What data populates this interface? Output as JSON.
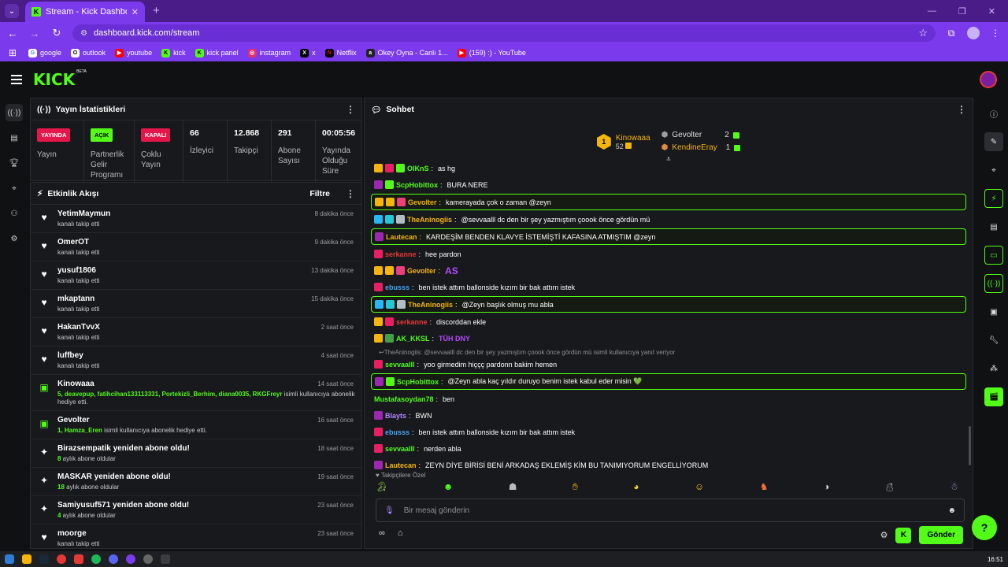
{
  "browser": {
    "tab_title": "Stream - Kick Dashboard",
    "url": "dashboard.kick.com/stream",
    "bookmarks": [
      "google",
      "outlook",
      "youtube",
      "kick",
      "kick panel",
      "instagram",
      "x",
      "Netflix",
      "Okey Oyna - Canlı 1...",
      "(159) :) - YouTube"
    ]
  },
  "brand": {
    "logo": "KICK",
    "beta": "BETA",
    "accent": "#53fc18"
  },
  "stats_panel": {
    "title": "Yayın İstatistikleri",
    "items": [
      {
        "badge": "YAYINDA",
        "label": "Yayın"
      },
      {
        "badge": "AÇIK",
        "label": "Partnerlik Gelir Programı"
      },
      {
        "badge": "KAPALI",
        "label": "Çoklu Yayın"
      },
      {
        "value": "66",
        "label": "İzleyici"
      },
      {
        "value": "12.868",
        "label": "Takipçi"
      },
      {
        "value": "291",
        "label": "Abone Sayısı"
      },
      {
        "value": "00:05:56",
        "label": "Yayında Olduğu Süre"
      }
    ]
  },
  "activity": {
    "title": "Etkinlik Akışı",
    "filter": "Filtre",
    "items": [
      {
        "icon": "heart-icon",
        "name": "YetimMaymun",
        "sub": "kanalı takip etti",
        "time": "8 dakika önce"
      },
      {
        "icon": "heart-icon",
        "name": "OmerOT",
        "sub": "kanalı takip etti",
        "time": "9 dakika önce"
      },
      {
        "icon": "heart-icon",
        "name": "yusuf1806",
        "sub": "kanalı takip etti",
        "time": "13 dakika önce"
      },
      {
        "icon": "heart-icon",
        "name": "mkaptann",
        "sub": "kanalı takip etti",
        "time": "15 dakika önce"
      },
      {
        "icon": "heart-icon",
        "name": "HakanTvvX",
        "sub": "kanalı takip etti",
        "time": "2 saat önce"
      },
      {
        "icon": "heart-icon",
        "name": "luffbey",
        "sub": "kanalı takip etti",
        "time": "4 saat önce"
      },
      {
        "icon": "gift-icon",
        "name": "Kinowaaa",
        "sub_green": "5, deavepup, fatihcihan133113331, Portekizli_Berhim, diana0035, RKGFreyr",
        "sub": " isimli kullanıcıya abonelik hediye etti.",
        "time": "14 saat önce"
      },
      {
        "icon": "gift-icon",
        "name": "Gevolter",
        "sub_green": "1, Hamza_Eren",
        "sub": " isimli kullanıcıya abonelik hediye etti.",
        "time": "16 saat önce"
      },
      {
        "icon": "sparkle-icon",
        "name": "Birazsempatik yeniden abone oldu!",
        "sub_green": "8",
        "sub": " aylık abone oldular",
        "time": "18 saat önce"
      },
      {
        "icon": "sparkle-icon",
        "name": "MASKAR yeniden abone oldu!",
        "sub_green": "18",
        "sub": " aylık abone oldular",
        "time": "19 saat önce"
      },
      {
        "icon": "sparkle-icon",
        "name": "Samiyusuf571 yeniden abone oldu!",
        "sub_green": "4",
        "sub": " aylık abone oldular",
        "time": "23 saat önce"
      },
      {
        "icon": "heart-icon",
        "name": "moorge",
        "sub": "kanalı takip etti",
        "time": "23 saat önce"
      }
    ]
  },
  "chat": {
    "title": "Sohbet",
    "leaders": {
      "first": {
        "rank": "1",
        "name": "Kinowaaa",
        "count": "52"
      },
      "second": {
        "name": "Gevolter",
        "count": "2"
      },
      "third": {
        "name": "KendineEray",
        "count": "1"
      }
    },
    "messages": [
      {
        "user": "OlKnS",
        "color": "#53fc18",
        "text": "as hg",
        "hl": false,
        "badges": [
          "#f5b50a",
          "#e91e63",
          "#53fc18"
        ]
      },
      {
        "user": "ScpHobittox",
        "color": "#53fc18",
        "text": "BURA NERE",
        "hl": false,
        "badges": [
          "#9c27b0",
          "#53fc18"
        ]
      },
      {
        "user": "Gevolter",
        "color": "#f5b50a",
        "text": "kamerayada çok o zaman @zeyn",
        "hl": true,
        "badges": [
          "#f5b50a",
          "#f5b50a",
          "#ec407a"
        ]
      },
      {
        "user": "TheAninogiis",
        "color": "#f5b50a",
        "text": "@sevvaalll dc den bir şey yazmıştım çoook önce gördün mü",
        "hl": false,
        "badges": [
          "#29b6f6",
          "#26c6da",
          "#b0bec5"
        ]
      },
      {
        "user": "Lautecan",
        "color": "#f5b50a",
        "text": "KARDEŞİM BENDEN KLAVYE İSTEMİŞTİ KAFASINA ATMIŞTIM @zeyn",
        "hl": true,
        "badges": [
          "#9c27b0"
        ]
      },
      {
        "user": "serkanne",
        "color": "#e53935",
        "text": "hee pardon",
        "hl": false,
        "badges": [
          "#e91e63"
        ]
      },
      {
        "user": "Gevolter",
        "color": "#f5b50a",
        "text": "AS",
        "hl": false,
        "badges": [
          "#f5b50a",
          "#f5b50a",
          "#ec407a"
        ],
        "emote": true
      },
      {
        "user": "ebusss",
        "color": "#42a5f5",
        "text": "ben istek attım ballonside kızım bir bak attım istek",
        "hl": false,
        "badges": [
          "#e91e63"
        ]
      },
      {
        "user": "TheAninogiis",
        "color": "#f5b50a",
        "text": "@Zeyn başlık olmuş mu abla",
        "hl": true,
        "badges": [
          "#29b6f6",
          "#26c6da",
          "#b0bec5"
        ]
      },
      {
        "user": "serkanne",
        "color": "#e53935",
        "text": "discorddan ekle",
        "hl": false,
        "badges": [
          "#f5b50a",
          "#e91e63"
        ]
      },
      {
        "user": "AK_KKSL",
        "color": "#53fc18",
        "text": "TÜH DNY",
        "hl": false,
        "badges": [
          "#f5b50a",
          "#43a047"
        ],
        "emote": true
      },
      {
        "reply": "TheAninogiis: @sevvaalll dc den bir şey yazmıştım çoook önce gördün mü isimli kullanıcıya yanıt veriyor"
      },
      {
        "user": "sevvaalll",
        "color": "#53fc18",
        "text": "yoo girmedim hiççç pardonn bakim hemen",
        "hl": false,
        "badges": [
          "#e91e63"
        ]
      },
      {
        "user": "ScpHobittox",
        "color": "#53fc18",
        "text": "@Zeyn abla kaç yıldır duruyo benim istek kabul eder misin 💚",
        "hl": true,
        "badges": [
          "#9c27b0",
          "#53fc18"
        ]
      },
      {
        "user": "Mustafasoydan78",
        "color": "#53fc18",
        "text": "ben",
        "hl": false,
        "badges": []
      },
      {
        "user": "Blayts",
        "color": "#b388ff",
        "text": "BWN",
        "hl": false,
        "badges": [
          "#9c27b0"
        ]
      },
      {
        "user": "ebusss",
        "color": "#42a5f5",
        "text": "ben istek attım ballonside kızım bir bak attım istek",
        "hl": false,
        "badges": [
          "#e91e63"
        ]
      },
      {
        "user": "sevvaalll",
        "color": "#53fc18",
        "text": "nerden abla",
        "hl": false,
        "badges": [
          "#e91e63"
        ]
      },
      {
        "user": "Lautecan",
        "color": "#f5b50a",
        "text": "ZEYN DİYE BİRİSİ BENİ ARKADAŞ EKLEMİŞ KİM BU TANIMIYORUM ENGELLİYORUM",
        "hl": false,
        "badges": [
          "#9c27b0"
        ]
      }
    ],
    "followers_only": "Takipçilere Özel",
    "input_placeholder": "Bir mesaj gönderin",
    "send": "Gönder"
  },
  "taskbar": {
    "clock": "16:51"
  }
}
